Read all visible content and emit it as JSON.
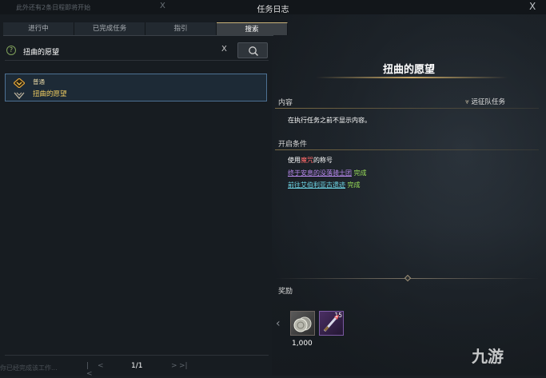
{
  "window": {
    "title": "任务日志",
    "notice": "此外还有2条日程即将开始",
    "notice_close": "X",
    "close": "X"
  },
  "tabs": [
    {
      "label": "进行中"
    },
    {
      "label": "已完成任务"
    },
    {
      "label": "指引"
    },
    {
      "label": "搜索"
    }
  ],
  "search": {
    "help": "?",
    "value": "扭曲的愿望",
    "clear": "X"
  },
  "results": [
    {
      "category": "普通",
      "name": "扭曲的愿望"
    }
  ],
  "pager": {
    "first": "|<",
    "prev": "<",
    "page": "1/1",
    "next": ">",
    "last": ">|"
  },
  "detail": {
    "title": "扭曲的愿望",
    "content_label": "内容",
    "type_label": "远征队任务",
    "content_text": "在执行任务之前不显示内容。",
    "condition_label": "开启条件",
    "conditions": {
      "c1_prefix": "使用",
      "c1_highlight": "魔咒",
      "c1_suffix": "的称号",
      "c2_link": "终于安息的没落骑士团",
      "c2_status": "完成",
      "c3_link": "前往艾伯利亚古遗迹",
      "c3_status": "完成"
    },
    "reward_label": "奖励",
    "rewards": [
      {
        "icon": "silver-coin-icon",
        "amount": "1,000"
      },
      {
        "icon": "weapon-item-icon",
        "count": "15"
      }
    ]
  },
  "watermark": "九游",
  "bottom_ghost": "你已经完成该工作..."
}
